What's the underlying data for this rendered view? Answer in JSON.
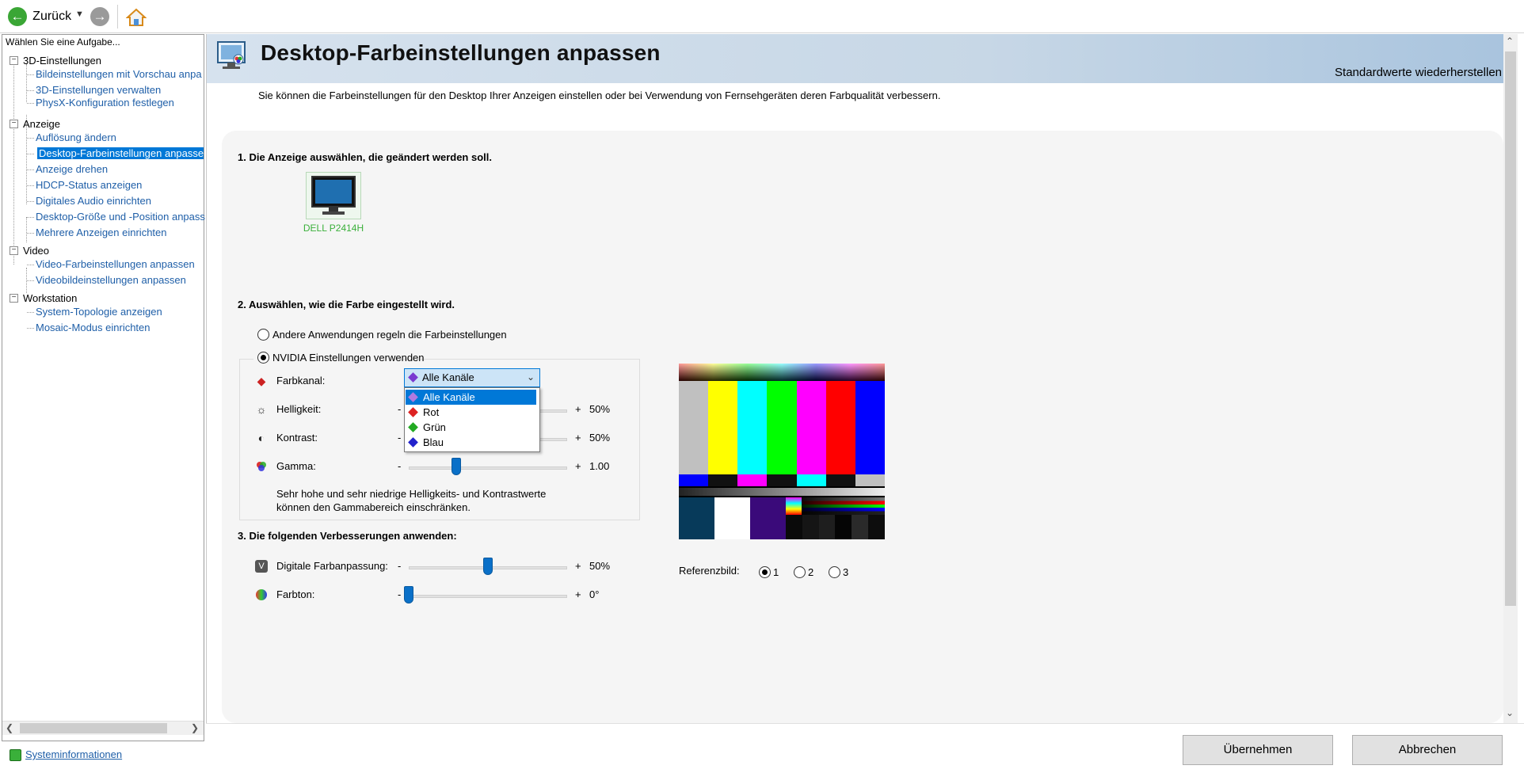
{
  "toolbar": {
    "back_label": "Zurück"
  },
  "sidebar": {
    "title": "Wählen Sie eine Aufgabe...",
    "categories": [
      {
        "label": "3D-Einstellungen",
        "items": [
          "Bildeinstellungen mit Vorschau anpa",
          "3D-Einstellungen verwalten",
          "PhysX-Konfiguration festlegen"
        ]
      },
      {
        "label": "Anzeige",
        "items": [
          "Auflösung ändern",
          "Desktop-Farbeinstellungen anpassen",
          "Anzeige drehen",
          "HDCP-Status anzeigen",
          "Digitales Audio einrichten",
          "Desktop-Größe und -Position anpass",
          "Mehrere Anzeigen einrichten"
        ]
      },
      {
        "label": "Video",
        "items": [
          "Video-Farbeinstellungen anpassen",
          "Videobildeinstellungen anpassen"
        ]
      },
      {
        "label": "Workstation",
        "items": [
          "System-Topologie anzeigen",
          "Mosaic-Modus einrichten"
        ]
      }
    ],
    "system_info": "Systeminformationen"
  },
  "header": {
    "title": "Desktop-Farbeinstellungen anpassen",
    "restore_defaults": "Standardwerte wiederherstellen"
  },
  "description": "Sie können die Farbeinstellungen für den Desktop Ihrer Anzeigen einstellen oder bei Verwendung von Fernsehgeräten deren Farbqualität verbessern.",
  "section1": {
    "title": "1. Die Anzeige auswählen, die geändert werden soll.",
    "display_name": "DELL P2414H"
  },
  "section2": {
    "title": "2. Auswählen, wie die Farbe eingestellt wird.",
    "option_other": "Andere Anwendungen regeln die Farbeinstellungen",
    "option_nvidia": "NVIDIA Einstellungen verwenden",
    "selected_option": "nvidia",
    "channel_label": "Farbkanal:",
    "channel_value": "Alle Kanäle",
    "channel_options": [
      "Alle Kanäle",
      "Rot",
      "Grün",
      "Blau"
    ],
    "brightness": {
      "label": "Helligkeit:",
      "value": "50%",
      "level": 0.5
    },
    "contrast": {
      "label": "Kontrast:",
      "value": "50%",
      "level": 0.5
    },
    "gamma": {
      "label": "Gamma:",
      "value": "1.00",
      "level": 0.3
    },
    "note_line1": "Sehr hohe und sehr niedrige Helligkeits- und Kontrastwerte",
    "note_line2": "können den Gammabereich einschränken.",
    "minus": "-",
    "plus": "+"
  },
  "section3": {
    "title": "3. Die folgenden Verbesserungen anwenden:",
    "vibrance": {
      "label": "Digitale Farbanpassung:",
      "value": "50%",
      "level": 0.5
    },
    "hue": {
      "label": "Farbton:",
      "value": "0°",
      "level": 0.0
    }
  },
  "reference": {
    "label": "Referenzbild:",
    "options": [
      "1",
      "2",
      "3"
    ],
    "selected": "1"
  },
  "buttons": {
    "apply": "Übernehmen",
    "cancel": "Abbrechen"
  },
  "colors": {
    "nvidia_green": "#3ab03a",
    "selection_blue": "#0078d7",
    "link_blue": "#1f5fa8",
    "slider_blue": "#0a70c8"
  }
}
